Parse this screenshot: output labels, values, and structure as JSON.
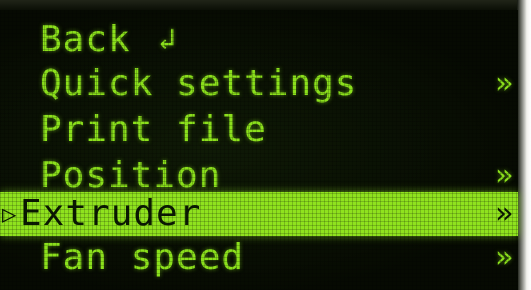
{
  "screen": {
    "colors": {
      "text": "#8be01c",
      "highlight_bg": "#8fe21e",
      "highlight_text": "#0b1a02",
      "lcd_bg": "#060a02"
    }
  },
  "menu": {
    "items": [
      {
        "label": "Back",
        "icon": "return-arrow-icon",
        "icon_glyph": "↲",
        "selected": false,
        "has_submenu": false
      },
      {
        "label": "Quick settings",
        "selected": false,
        "has_submenu": true,
        "submenu_glyph": "»"
      },
      {
        "label": "Print file",
        "selected": false,
        "has_submenu": false
      },
      {
        "label": "Position",
        "selected": false,
        "has_submenu": true,
        "submenu_glyph": "»"
      },
      {
        "label": "Extruder",
        "selected": true,
        "has_submenu": true,
        "submenu_glyph": "»",
        "cursor_glyph": "▷"
      },
      {
        "label": "Fan speed",
        "selected": false,
        "has_submenu": true,
        "submenu_glyph": "»"
      }
    ]
  }
}
